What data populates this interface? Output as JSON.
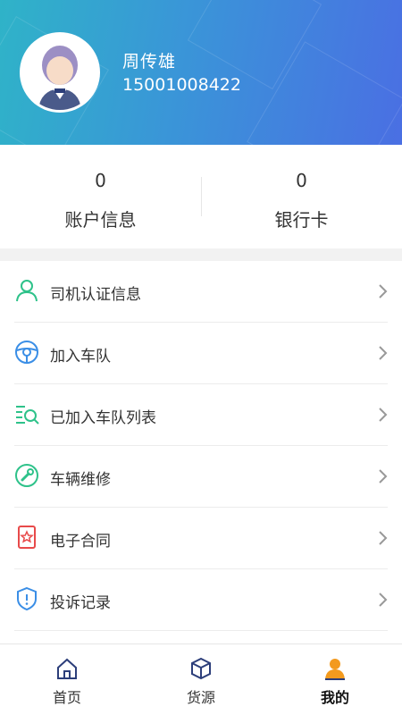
{
  "profile": {
    "name": "周传雄",
    "phone": "15001008422"
  },
  "stats": [
    {
      "value": "0",
      "label": "账户信息"
    },
    {
      "value": "0",
      "label": "银行卡"
    }
  ],
  "menu": [
    {
      "label": "司机认证信息",
      "icon": "user-icon"
    },
    {
      "label": "加入车队",
      "icon": "steering-wheel-icon"
    },
    {
      "label": "已加入车队列表",
      "icon": "list-search-icon"
    },
    {
      "label": "车辆维修",
      "icon": "wrench-icon"
    },
    {
      "label": "电子合同",
      "icon": "contract-icon"
    },
    {
      "label": "投诉记录",
      "icon": "shield-alert-icon"
    }
  ],
  "tabbar": [
    {
      "label": "首页",
      "icon": "home-icon",
      "active": false
    },
    {
      "label": "货源",
      "icon": "cube-icon",
      "active": false
    },
    {
      "label": "我的",
      "icon": "person-icon",
      "active": true
    }
  ],
  "colors": {
    "header_start": "#2fb3c8",
    "header_end": "#4a6fe3",
    "green": "#2ec28a",
    "blue": "#3a8ee6",
    "red": "#e84a4a",
    "orange": "#f39a1e",
    "navy": "#2c3e7a"
  }
}
